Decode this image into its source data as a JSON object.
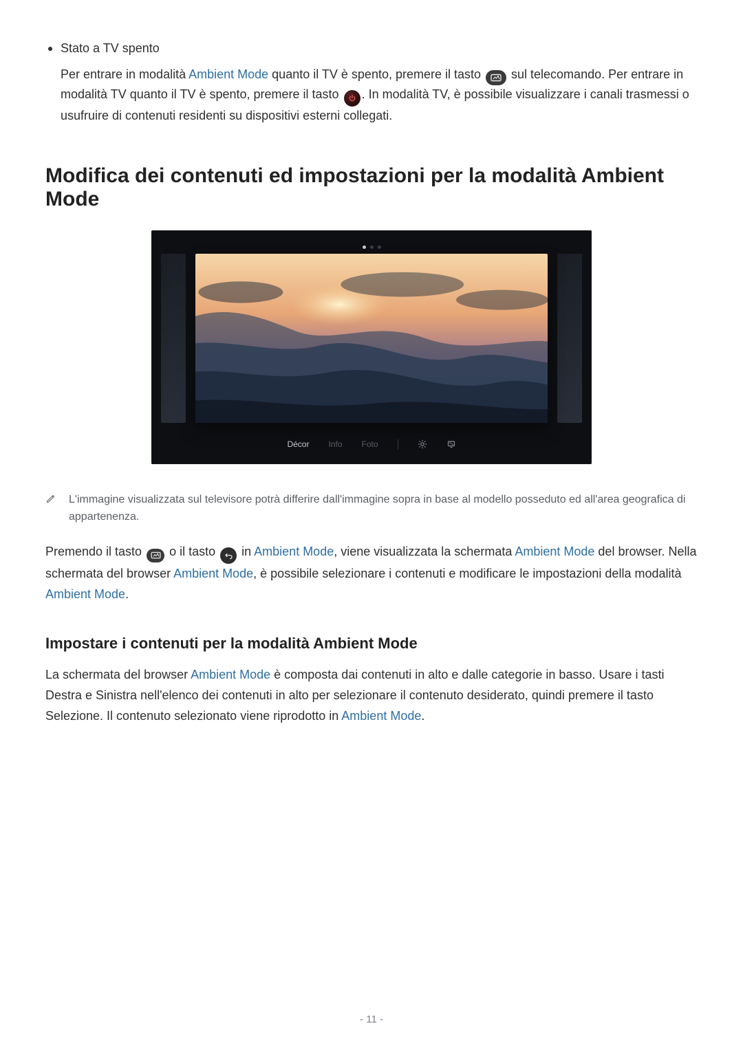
{
  "bullet": {
    "title": "Stato a TV spento",
    "body": {
      "p1a": "Per entrare in modalità ",
      "link1": "Ambient Mode",
      "p1b": " quanto il TV è spento, premere il tasto ",
      "p1c": " sul telecomando. Per entrare in modalità TV quanto il TV è spento, premere il tasto ",
      "p1d": ". In modalità TV, è possibile visualizzare i canali trasmessi o usufruire di contenuti residenti su dispositivi esterni collegati."
    }
  },
  "section_h": "Modifica dei contenuti ed impostazioni per la modalità Ambient Mode",
  "tv": {
    "tabs": [
      "Décor",
      "Info",
      "Foto"
    ]
  },
  "note": "L'immagine visualizzata sul televisore potrà differire dall'immagine sopra in base al modello posseduto ed all'area geografica di appartenenza.",
  "para1": {
    "a": "Premendo il tasto ",
    "b": " o il tasto ",
    "c": " in ",
    "link1": "Ambient Mode",
    "d": ", viene visualizzata la schermata ",
    "link2": "Ambient Mode",
    "e": " del browser. Nella schermata del browser ",
    "link3": "Ambient Mode",
    "f": ", è possibile selezionare i contenuti e modificare le impostazioni della modalità ",
    "link4": "Ambient Mode",
    "g": "."
  },
  "sub_h": "Impostare i contenuti per la modalità Ambient Mode",
  "para2": {
    "a": "La schermata del browser ",
    "link1": "Ambient Mode",
    "b": " è composta dai contenuti in alto e dalle categorie in basso. Usare i tasti Destra e Sinistra nell'elenco dei contenuti in alto per selezionare il contenuto desiderato, quindi premere il tasto Selezione. Il contenuto selezionato viene riprodotto in ",
    "link2": "Ambient Mode",
    "c": "."
  },
  "page_number": "- 11 -"
}
